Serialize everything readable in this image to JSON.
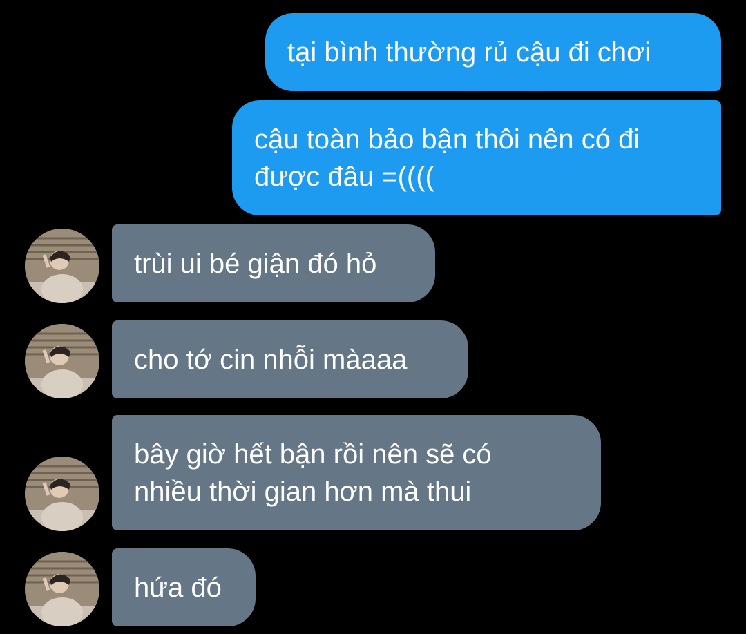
{
  "conversation": {
    "messages": [
      {
        "direction": "outgoing",
        "text": "tại bình thường rủ cậu đi chơi"
      },
      {
        "direction": "outgoing",
        "text": "cậu toàn bảo bận thôi nên có đi\nđược đâu =(((("
      },
      {
        "direction": "incoming",
        "text": "trùi ui bé giận đó hỏ"
      },
      {
        "direction": "incoming",
        "text": "cho tớ cin nhỗi màaaa"
      },
      {
        "direction": "incoming",
        "text": "bây giờ hết bận rồi nên sẽ có\nnhiều thời gian hơn mà thui"
      },
      {
        "direction": "incoming",
        "text": "hứa đó"
      }
    ]
  },
  "colors": {
    "background": "#000000",
    "outgoing_bubble": "#1d9bf0",
    "incoming_bubble": "#657786",
    "text": "#ffffff"
  },
  "icons": {
    "avatar": "contact-avatar-photo"
  }
}
